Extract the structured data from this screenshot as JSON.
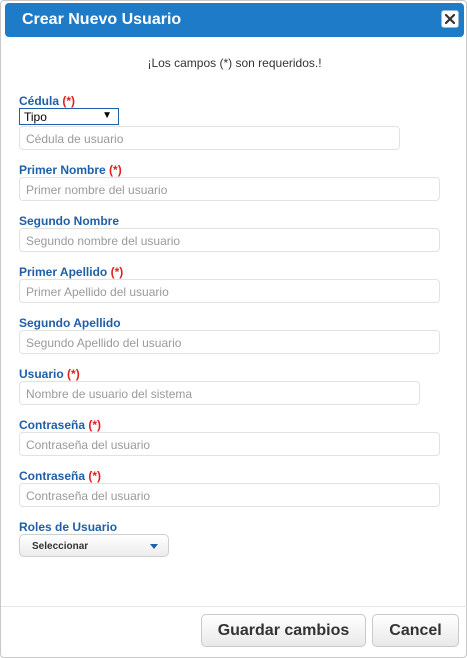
{
  "dialog": {
    "title": "Crear Nuevo Usuario",
    "required_note_prefix": "¡Los campos ",
    "required_note_mark": "(*)",
    "required_note_suffix": " son requeridos.!"
  },
  "form": {
    "required_mark": "(*)",
    "cedula": {
      "label": "Cédula",
      "type_select": "Tipo",
      "placeholder": "Cédula de usuario"
    },
    "primer_nombre": {
      "label": "Primer Nombre",
      "placeholder": "Primer nombre del usuario"
    },
    "segundo_nombre": {
      "label": "Segundo Nombre",
      "placeholder": "Segundo nombre del usuario"
    },
    "primer_apellido": {
      "label": "Primer Apellido",
      "placeholder": "Primer Apellido del usuario"
    },
    "segundo_apellido": {
      "label": "Segundo Apellido",
      "placeholder": "Segundo Apellido del usuario"
    },
    "usuario": {
      "label": "Usuario",
      "placeholder": "Nombre de usuario del sistema"
    },
    "contrasena": {
      "label": "Contraseña",
      "placeholder": "Contraseña del usuario"
    },
    "contrasena_confirm": {
      "label": "Contraseña",
      "placeholder": "Contraseña del usuario"
    },
    "roles": {
      "label": "Roles de Usuario",
      "selected": "Seleccionar"
    }
  },
  "footer": {
    "save_label": "Guardar cambios",
    "cancel_label": "Cancel"
  },
  "colors": {
    "titlebar": "#1e7bc8",
    "label": "#1f5fa8",
    "required": "#e02020"
  },
  "icons": {
    "close": "close-icon",
    "select_arrow": "chevron-down-icon"
  }
}
